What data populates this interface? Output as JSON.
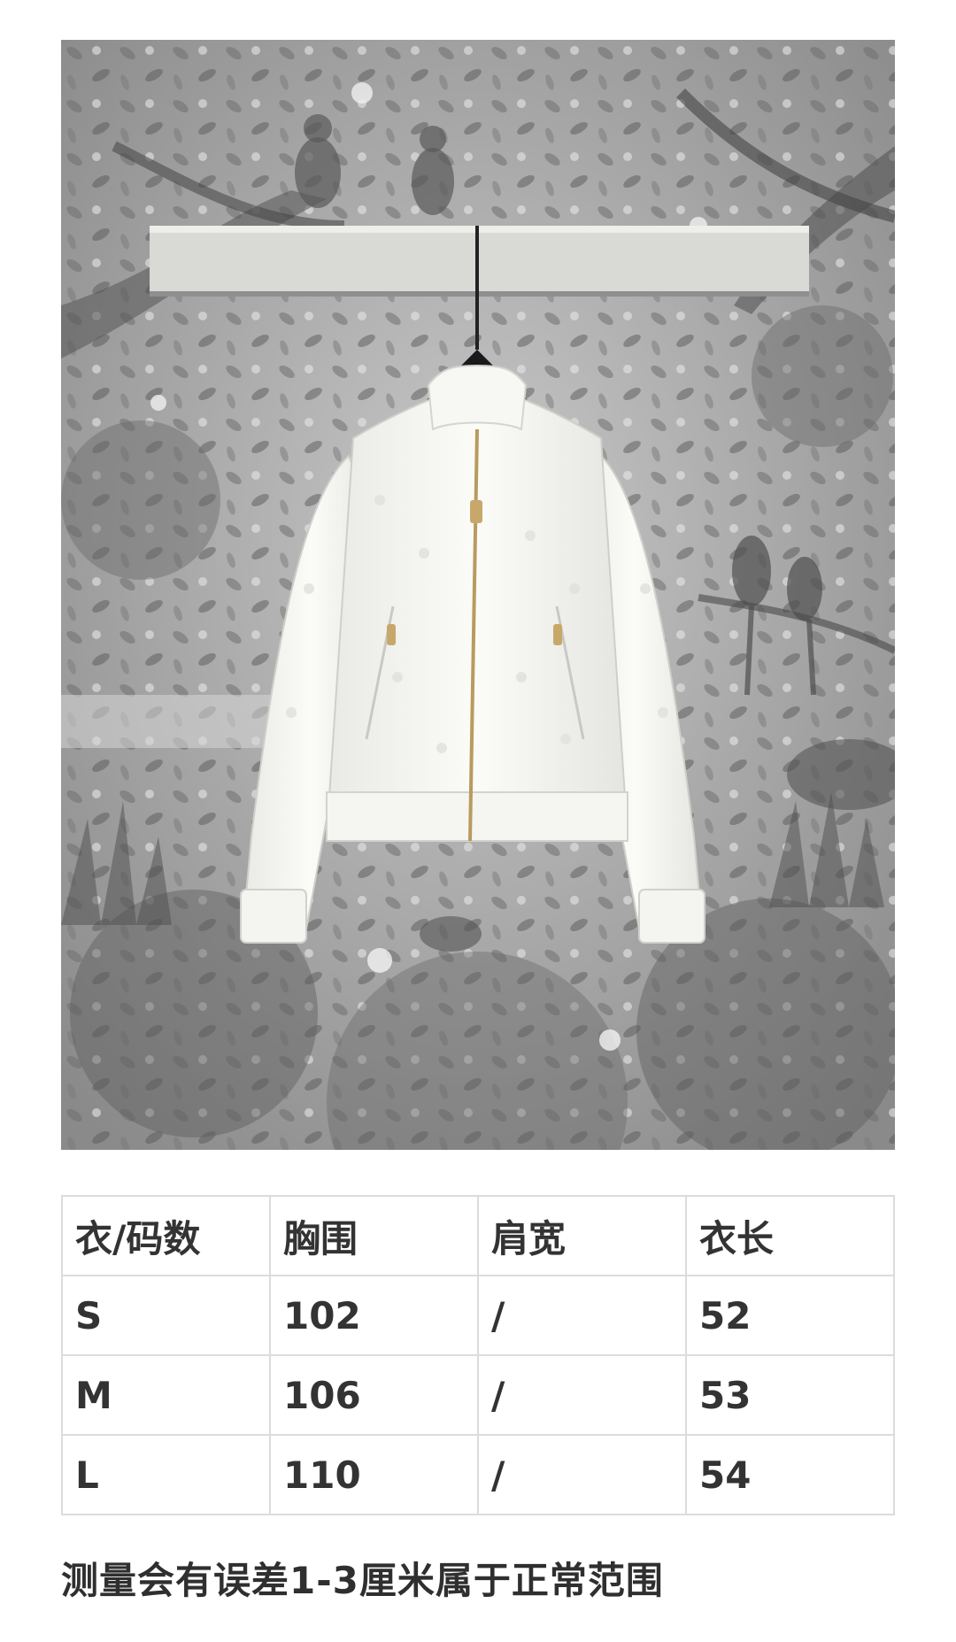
{
  "photo": {
    "subject": "white-bomber-jacket-icon",
    "background": "toile-forest-wallpaper-icon"
  },
  "size_table": {
    "headers": [
      "衣/码数",
      "胸围",
      "肩宽",
      "衣长"
    ],
    "rows": [
      [
        "S",
        "102",
        "/",
        "52"
      ],
      [
        "M",
        "106",
        "/",
        "53"
      ],
      [
        "L",
        "110",
        "/",
        "54"
      ]
    ]
  },
  "note": "测量会有误差1-3厘米属于正常范围"
}
